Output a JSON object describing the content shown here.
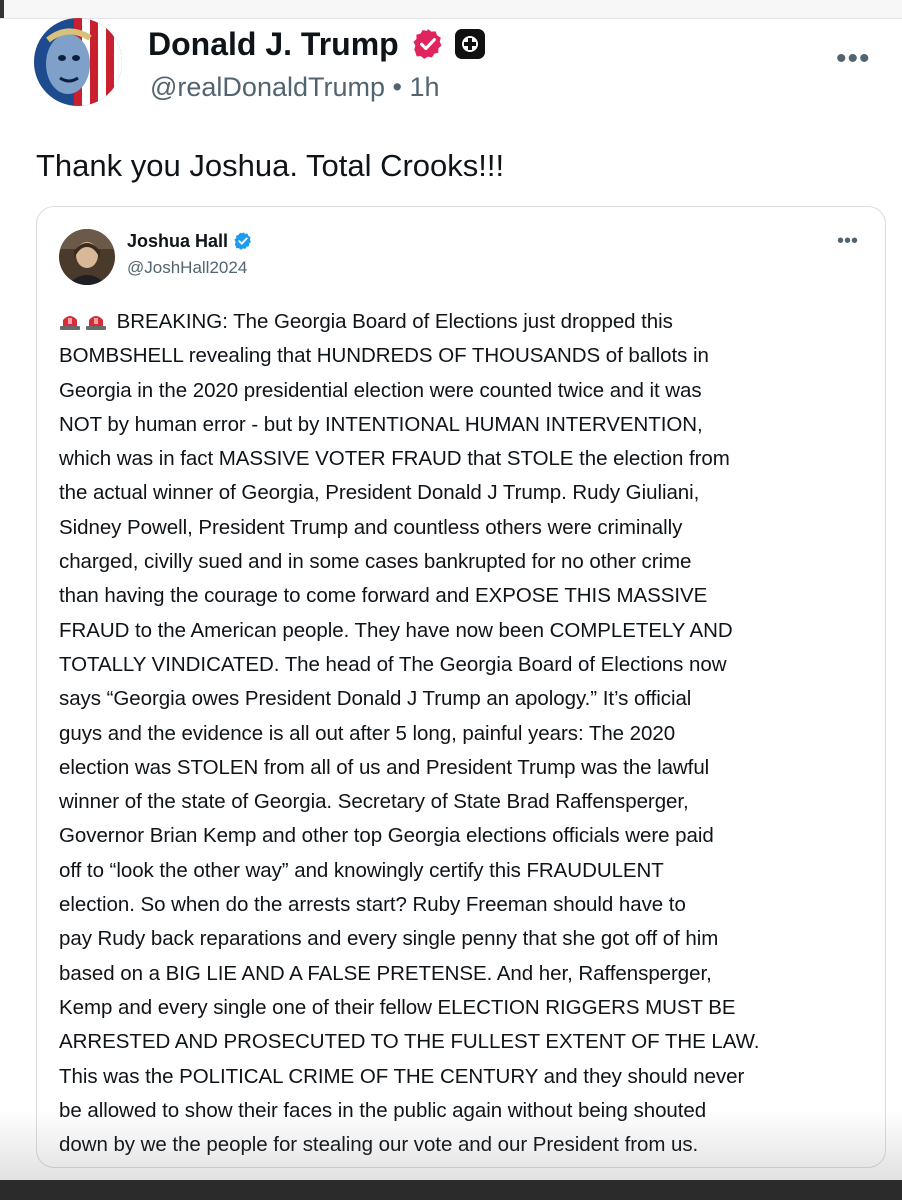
{
  "post": {
    "author_name": "Donald J. Trump",
    "handle": "@realDonaldTrump",
    "separator": "•",
    "time": "1h",
    "more_label": "•••",
    "text": "Thank you Joshua. Total Crooks!!!"
  },
  "quoted_post": {
    "author_name": "Joshua Hall",
    "handle": "@JoshHall2024",
    "more_label": "•••",
    "lines": [
      "BREAKING: The Georgia Board of Elections just dropped this",
      "BOMBSHELL revealing that HUNDREDS OF THOUSANDS of ballots in",
      "Georgia in the 2020 presidential election were counted twice and it was",
      "NOT by human error - but by INTENTIONAL HUMAN INTERVENTION,",
      "which was in fact MASSIVE VOTER FRAUD that STOLE the election from",
      "the actual winner of Georgia, President Donald J Trump. Rudy Giuliani,",
      "Sidney Powell, President Trump and countless others were criminally",
      "charged, civilly sued and in some cases bankrupted for no other crime",
      "than having the courage to come forward and EXPOSE THIS MASSIVE",
      "FRAUD to the American people. They have now been COMPLETELY AND",
      "TOTALLY VINDICATED. The head of The Georgia Board of Elections now",
      "says “Georgia owes President Donald J Trump an apology.” It’s official",
      "guys and the evidence is all out after 5 long, painful years: The 2020",
      "election was STOLEN from all of us and President Trump was the lawful",
      "winner of the state of Georgia. Secretary of State Brad Raffensperger,",
      "Governor Brian Kemp and other top Georgia elections officials were paid",
      "off to “look the other way” and knowingly certify this FRAUDULENT",
      "election. So when do the arrests start? Ruby Freeman should have to",
      "pay Rudy back reparations and every single penny that she got off of him",
      "based on a BIG LIE AND A FALSE PRETENSE. And her, Raffensperger,",
      "Kemp and every single one of their fellow ELECTION RIGGERS MUST BE",
      "ARRESTED AND PROSECUTED TO THE FULLEST EXTENT OF THE LAW.",
      "This was the POLITICAL CRIME OF THE CENTURY and they should never",
      "be allowed to show their faces in the public again without being shouted",
      "down by we the people for stealing our vote and our President from us."
    ],
    "leading_icons": [
      "siren-icon",
      "siren-icon"
    ]
  },
  "colors": {
    "text": "#0f1419",
    "secondary": "#536471",
    "verified_pink": "#e0245e",
    "verified_blue": "#1d9bf0",
    "siren_red": "#d62c3b",
    "border": "#d8dde1"
  }
}
